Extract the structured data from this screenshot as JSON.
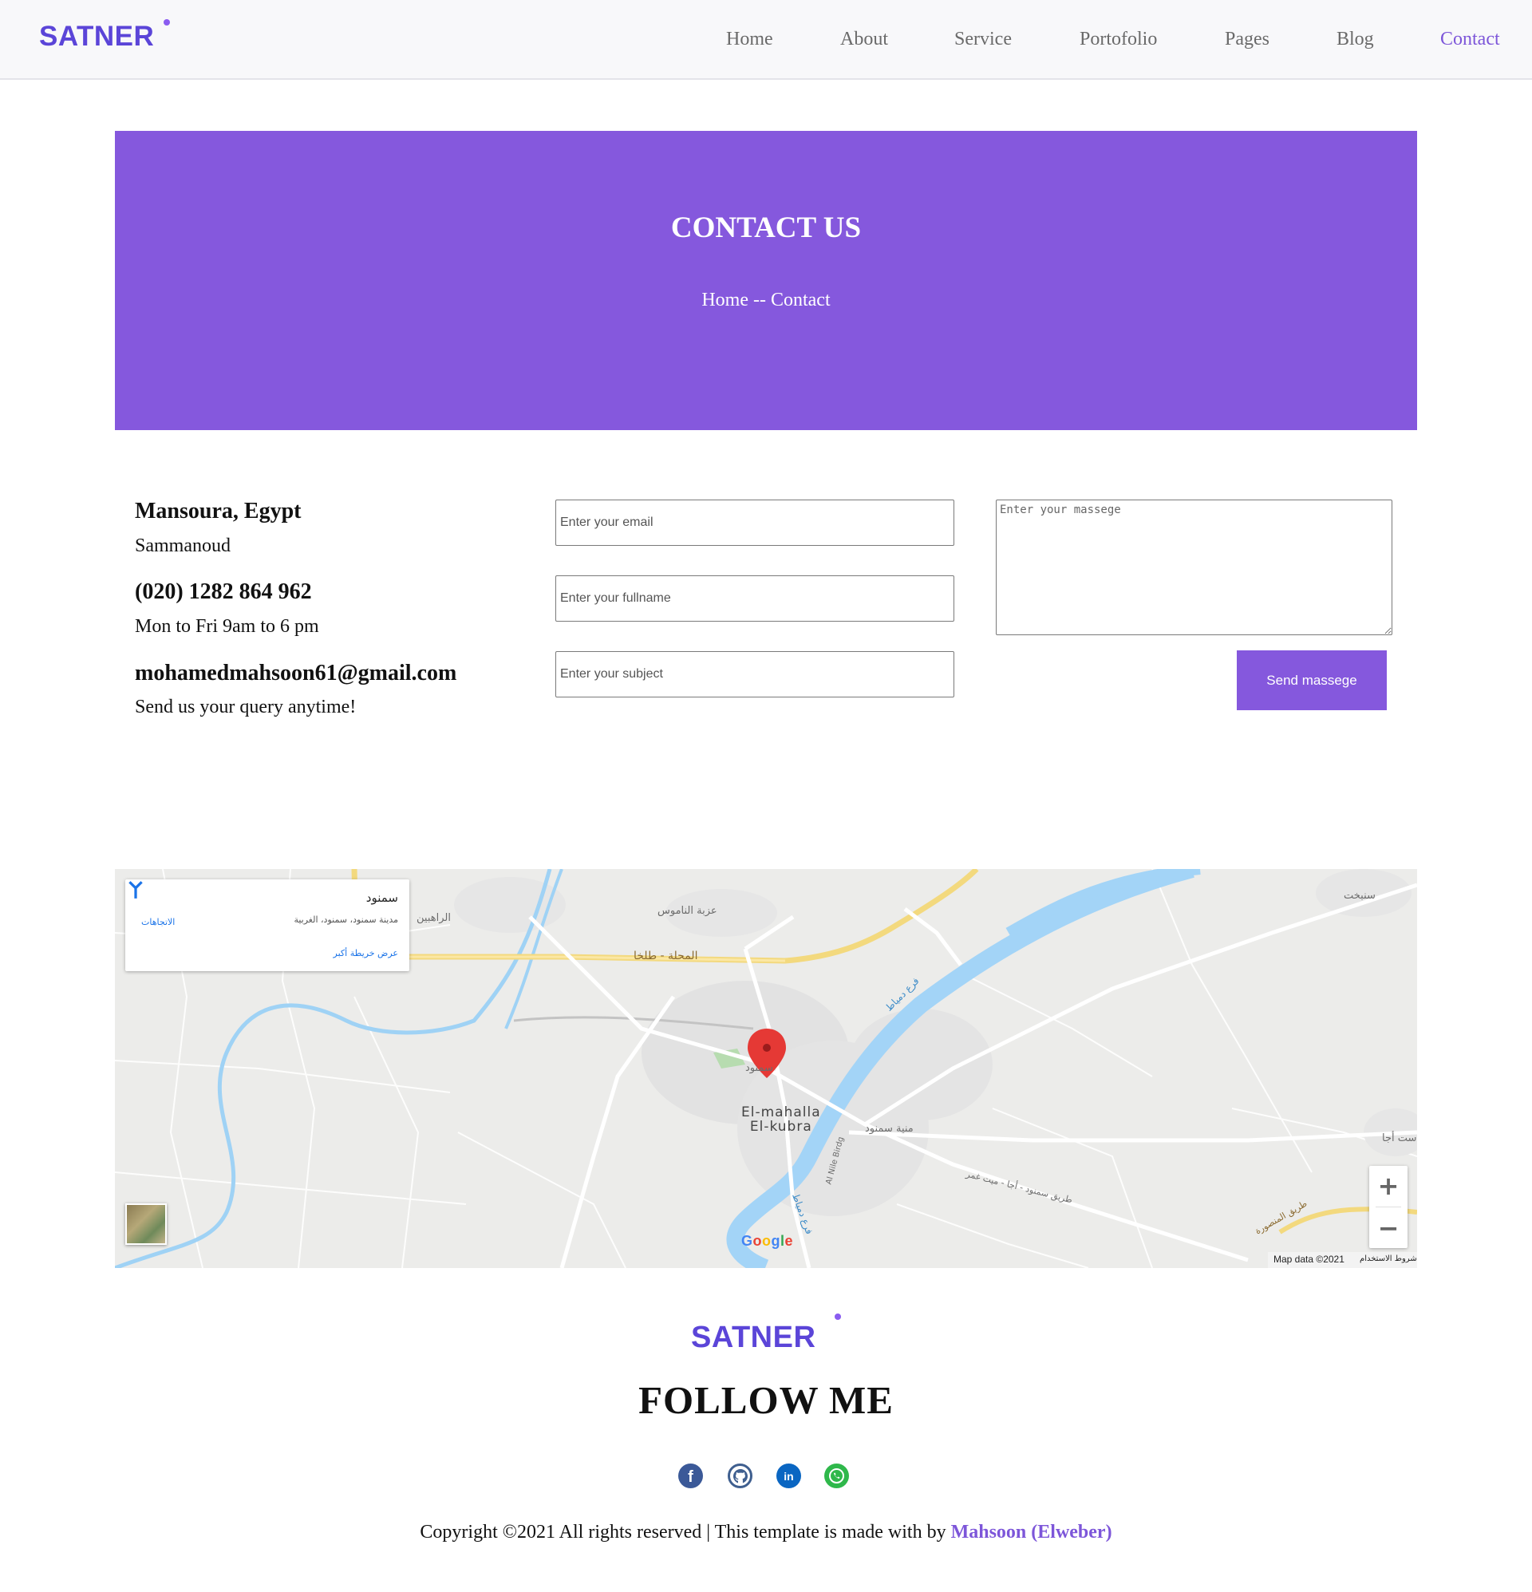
{
  "brand": {
    "name": "SATNER",
    "color": "#5b45d8",
    "accent": "#8558dd"
  },
  "nav": {
    "items": [
      {
        "label": "Home"
      },
      {
        "label": "About"
      },
      {
        "label": "Service"
      },
      {
        "label": "Portofolio"
      },
      {
        "label": "Pages"
      },
      {
        "label": "Blog"
      },
      {
        "label": "Contact",
        "active": true
      }
    ]
  },
  "hero": {
    "title": "CONTACT US",
    "breadcrumb": "Home -- Contact"
  },
  "contact_info": {
    "address": {
      "heading": "Mansoura, Egypt",
      "detail": "Sammanoud"
    },
    "phone": {
      "heading": "(020) 1282 864 962",
      "detail": "Mon to Fri 9am to 6 pm"
    },
    "email": {
      "heading": "mohamedmahsoon61@gmail.com",
      "detail": "Send us your query anytime!"
    }
  },
  "form": {
    "email_placeholder": "Enter your email",
    "fullname_placeholder": "Enter your fullname",
    "subject_placeholder": "Enter your subject",
    "message_placeholder": "Enter your massege",
    "submit_label": "Send massege"
  },
  "map": {
    "place_card": {
      "name": "سمنود",
      "address": "مدينة سمنود، سمنود، الغربية",
      "larger_map_link": "عرض خريطة أكبر",
      "directions_label": "الاتجاهات",
      "directions_icon": "directions-icon"
    },
    "labels": {
      "village_north": "عزبة الناموس",
      "village_west": "الراهبين",
      "town_east": "سنبخت",
      "road_main": "المحلة - طلخا",
      "city_marker": "سمنود",
      "city_en": "El-mahalla\nEl-kubra",
      "district": "منية سمنود",
      "bridge": "Al Nile Birdg",
      "river_east": "فرع دمياط",
      "river_south": "فرع دمياط",
      "road_south": "طريق سمنود - أجا - ميت غمر",
      "road_southeast": "طريق المنصورة",
      "town_edge": "ست أجا"
    },
    "zoom_in": "+",
    "zoom_out": "−",
    "attribution": "Map data ©2021",
    "terms": "شروط الاستخدام",
    "google_logo": "Google"
  },
  "footer": {
    "logo": "SATNER",
    "follow_title": "FOLLOW ME",
    "social": [
      {
        "name": "facebook",
        "icon": "facebook-icon",
        "color": "#3b5998"
      },
      {
        "name": "github",
        "icon": "github-icon",
        "color": "#222222"
      },
      {
        "name": "linkedin",
        "icon": "linkedin-icon",
        "color": "#0a66c2"
      },
      {
        "name": "whatsapp",
        "icon": "whatsapp-icon",
        "color": "#25d366"
      }
    ],
    "copyright_prefix": "Copyright ©2021 All rights reserved | This template is made with by ",
    "copyright_author": "Mahsoon (Elweber)"
  }
}
